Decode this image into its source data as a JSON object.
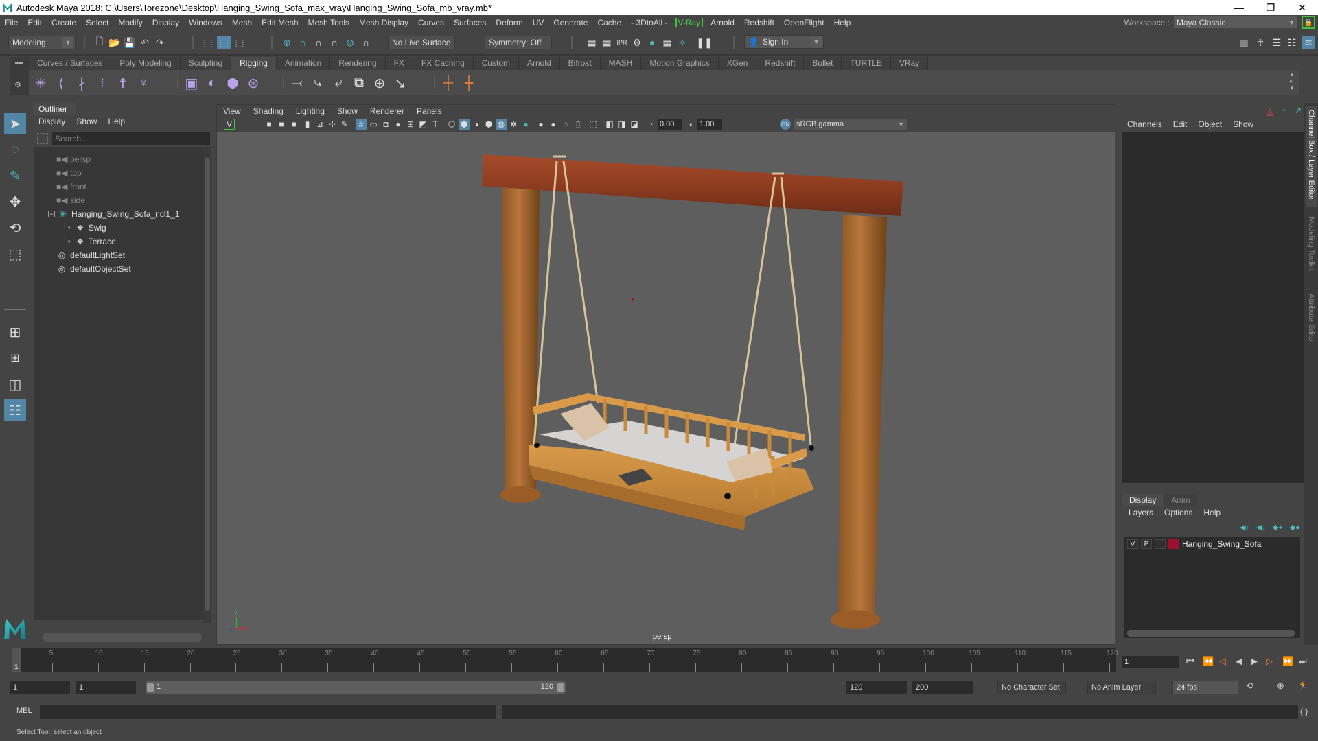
{
  "window": {
    "title": "Autodesk Maya 2018: C:\\Users\\Torezone\\Desktop\\Hanging_Swing_Sofa_max_vray\\Hanging_Swing_Sofa_mb_vray.mb*",
    "minimize": "—",
    "restore": "❐",
    "close": "✕"
  },
  "menubar": {
    "items": [
      "File",
      "Edit",
      "Create",
      "Select",
      "Modify",
      "Display",
      "Windows",
      "Mesh",
      "Edit Mesh",
      "Mesh Tools",
      "Mesh Display",
      "Curves",
      "Surfaces",
      "Deform",
      "UV",
      "Generate",
      "Cache",
      "- 3DtoAll -",
      "V-Ray",
      "Arnold",
      "Redshift",
      "OpenFlight",
      "Help"
    ],
    "workspace_label": "Workspace :",
    "workspace_value": "Maya Classic"
  },
  "statusline": {
    "menuset": "Modeling",
    "live_surface": "No Live Surface",
    "symmetry": "Symmetry: Off",
    "sign_in": "Sign In"
  },
  "shelf": {
    "tabs": [
      "Curves / Surfaces",
      "Poly Modeling",
      "Sculpting",
      "Rigging",
      "Animation",
      "Rendering",
      "FX",
      "FX Caching",
      "Custom",
      "Arnold",
      "Bifrost",
      "MASH",
      "Motion Graphics",
      "XGen",
      "Redshift",
      "Bullet",
      "TURTLE",
      "VRay"
    ],
    "active_tab": "Rigging"
  },
  "outliner": {
    "title": "Outliner",
    "menu": [
      "Display",
      "Show",
      "Help"
    ],
    "search_placeholder": "Search...",
    "items": [
      {
        "label": "persp",
        "type": "camera"
      },
      {
        "label": "top",
        "type": "camera"
      },
      {
        "label": "front",
        "type": "camera"
      },
      {
        "label": "side",
        "type": "camera"
      },
      {
        "label": "Hanging_Swing_Sofa_ncl1_1",
        "type": "group"
      },
      {
        "label": "Swig",
        "type": "transform"
      },
      {
        "label": "Terrace",
        "type": "transform"
      },
      {
        "label": "defaultLightSet",
        "type": "set"
      },
      {
        "label": "defaultObjectSet",
        "type": "set"
      }
    ]
  },
  "viewport": {
    "menu": [
      "View",
      "Shading",
      "Lighting",
      "Show",
      "Renderer",
      "Panels"
    ],
    "exposure": "0.00",
    "gamma": "1.00",
    "color_space": "sRGB gamma",
    "camera_label": "persp",
    "axis": {
      "x": "x",
      "y": "y",
      "z": "z"
    }
  },
  "channelbox": {
    "menu": [
      "Channels",
      "Edit",
      "Object",
      "Show"
    ]
  },
  "layereditor": {
    "tabs": [
      "Display",
      "Anim"
    ],
    "active_tab": "Display",
    "menu": [
      "Layers",
      "Options",
      "Help"
    ],
    "layers": [
      {
        "v": "V",
        "p": "P",
        "name": "Hanging_Swing_Sofa",
        "color": "#9a1030"
      }
    ]
  },
  "side_tabs": [
    "Channel Box / Layer Editor",
    "Modeling Toolkit",
    "Attribute Editor"
  ],
  "timeline": {
    "ticks": [
      "5",
      "10",
      "15",
      "20",
      "25",
      "30",
      "35",
      "40",
      "45",
      "50",
      "55",
      "60",
      "65",
      "70",
      "75",
      "80",
      "85",
      "90",
      "95",
      "100",
      "105",
      "110",
      "115",
      "120"
    ],
    "current_frame": "1",
    "frame_field": "1",
    "range_start": "1",
    "playback_start": "1",
    "range_slider_start": "1",
    "range_slider_end": "120",
    "playback_end": "120",
    "range_end": "200",
    "character_set": "No Character Set",
    "anim_layer": "No Anim Layer",
    "fps": "24 fps"
  },
  "commandline": {
    "label": "MEL"
  },
  "helpline": {
    "text": "Select Tool: select an object"
  }
}
